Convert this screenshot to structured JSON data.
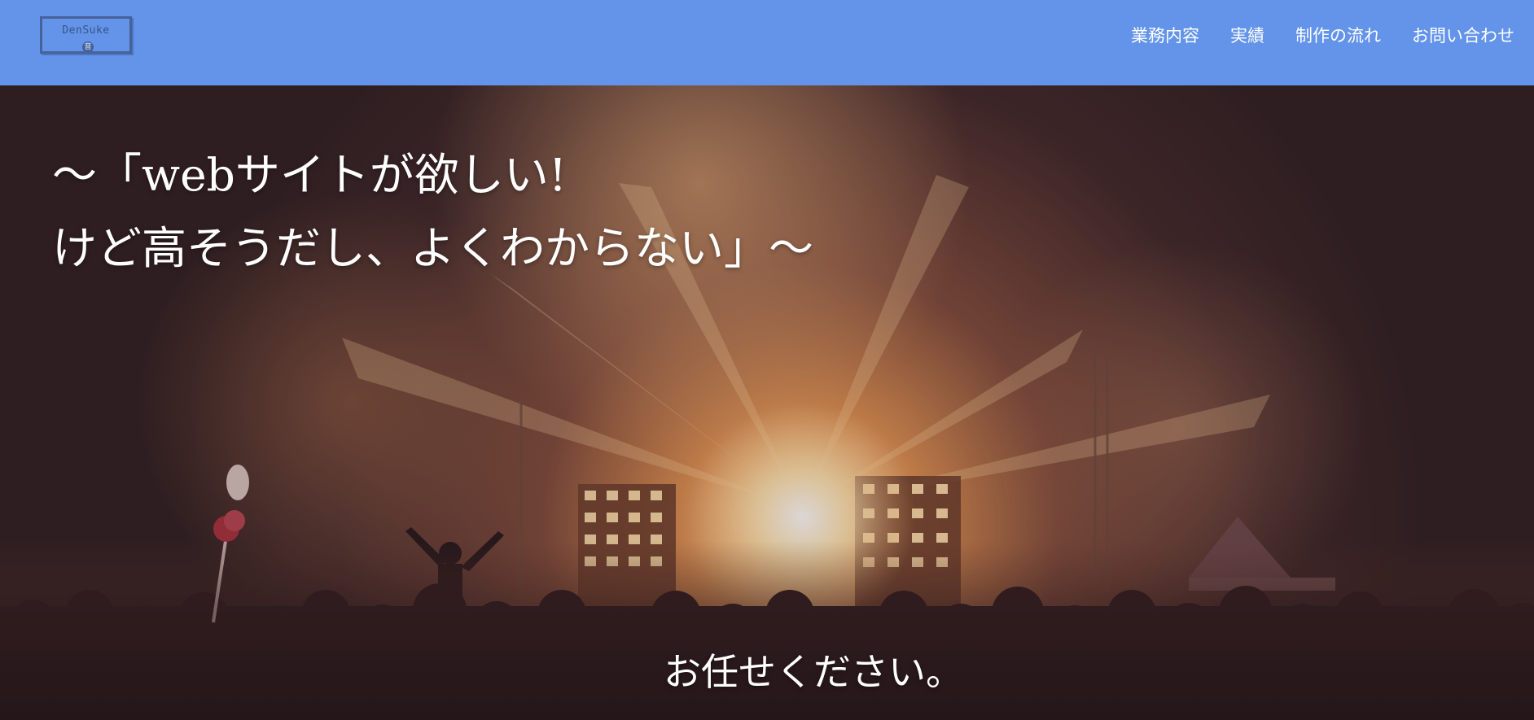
{
  "header": {
    "logo_text": "DenSuke",
    "logo_mark": "音",
    "nav": [
      {
        "label": "業務内容"
      },
      {
        "label": "実績"
      },
      {
        "label": "制作の流れ"
      },
      {
        "label": "お問い合わせ"
      }
    ],
    "background_color": "#6394ea"
  },
  "hero": {
    "background_image": "concert-crowd-stage-lights",
    "headline_line1": "〜「webサイトが欲しい!",
    "headline_line2": "けど高そうだし、よくわからない」〜",
    "tagline": "お任せください。"
  }
}
